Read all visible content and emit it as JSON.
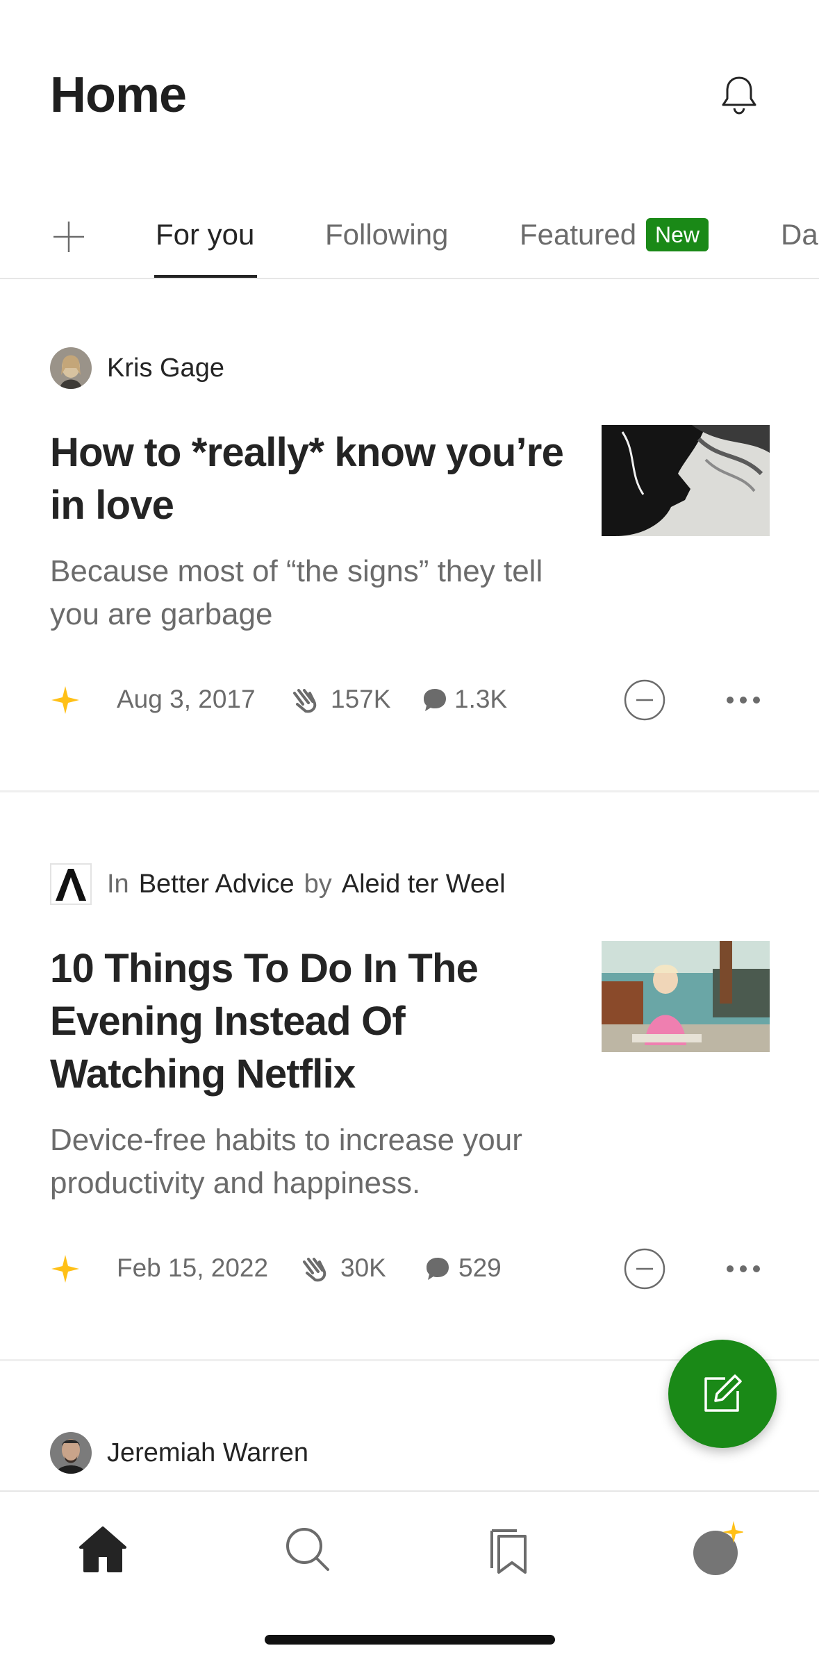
{
  "header": {
    "title": "Home"
  },
  "tabs": [
    {
      "label": "For you",
      "active": true
    },
    {
      "label": "Following",
      "active": false
    },
    {
      "label": "Featured",
      "active": false,
      "badge": "New"
    },
    {
      "label": "Da",
      "active": false
    }
  ],
  "articles": [
    {
      "author": "Kris Gage",
      "title": "How to *really* know you’re in love",
      "subtitle": "Because most of “the signs” they tell you are garbage",
      "date": "Aug 3, 2017",
      "claps": "157K",
      "comments": "1.3K"
    },
    {
      "in_label": "In",
      "publication": "Better Advice",
      "by_label": "by",
      "author": "Aleid ter Weel",
      "title": "10 Things To Do In The Evening Instead Of Watching Netflix",
      "subtitle": "Device-free habits to increase your productivity and happiness.",
      "date": "Feb 15, 2022",
      "claps": "30K",
      "comments": "529"
    },
    {
      "author": "Jeremiah Warren"
    }
  ],
  "icons": {
    "notifications": "bell-icon",
    "add_topic": "plus-icon",
    "member_only": "star-icon",
    "claps": "clap-icon",
    "comments": "comment-icon",
    "show_less": "circle-minus-icon",
    "more": "more-icon",
    "write": "write-icon",
    "nav": [
      "home-icon",
      "search-icon",
      "bookmarks-icon",
      "profile-icon"
    ]
  },
  "colors": {
    "accent": "#1a8917",
    "star": "#ffc017",
    "text": "#242424",
    "muted": "#6b6b6b"
  }
}
